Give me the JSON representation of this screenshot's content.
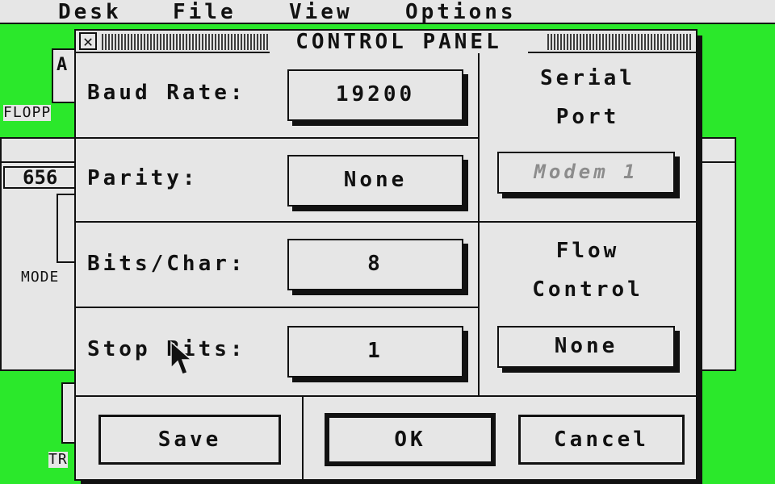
{
  "menubar": {
    "items": [
      {
        "label": "Desk"
      },
      {
        "label": "File"
      },
      {
        "label": "View"
      },
      {
        "label": "Options"
      }
    ]
  },
  "desktop": {
    "background_color": "#2be82b",
    "icons": [
      {
        "label": "FLOPP",
        "glyph": "A"
      },
      {
        "label": "MODE"
      },
      {
        "label": "TR"
      }
    ],
    "window_field": "656"
  },
  "dialog": {
    "title": "CONTROL PANEL",
    "close_glyph": "✕",
    "rows": [
      {
        "label": "Baud Rate:",
        "value": "19200"
      },
      {
        "label": "Parity:",
        "value": "None"
      },
      {
        "label": "Bits/Char:",
        "value": "8"
      },
      {
        "label": "Stop Bits:",
        "value": "1"
      }
    ],
    "serial_port": {
      "title_line1": "Serial",
      "title_line2": "Port",
      "value": "Modem 1"
    },
    "flow_control": {
      "title_line1": "Flow",
      "title_line2": "Control",
      "value": "None"
    },
    "buttons": {
      "save": "Save",
      "ok": "OK",
      "cancel": "Cancel"
    }
  }
}
